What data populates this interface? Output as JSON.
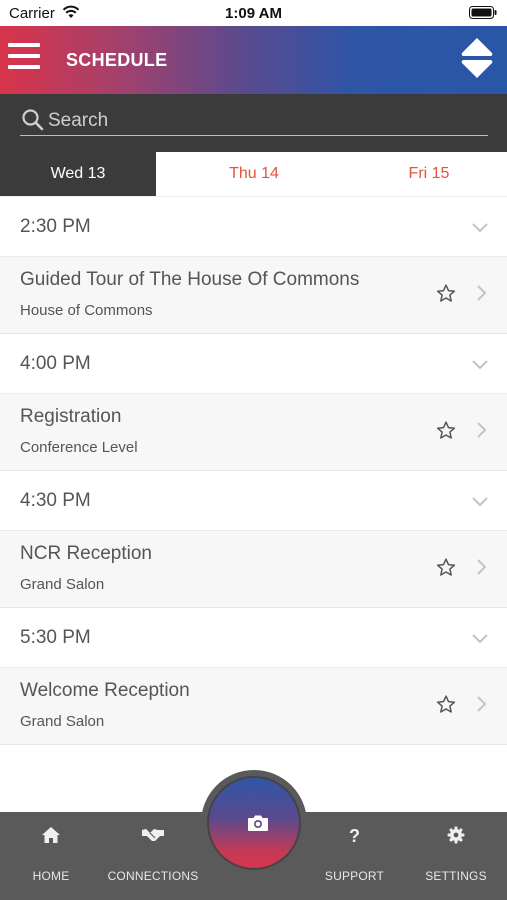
{
  "status_bar": {
    "carrier": "Carrier",
    "time": "1:09 AM"
  },
  "header": {
    "title": "SCHEDULE",
    "menu_icon": "hamburger-menu-icon",
    "sort_icon": "sort-up-down-icon"
  },
  "search": {
    "placeholder": "Search",
    "value": ""
  },
  "tabs": [
    {
      "label": "Wed 13",
      "active": true
    },
    {
      "label": "Thu 14",
      "active": false
    },
    {
      "label": "Fri 15",
      "active": false
    }
  ],
  "schedule": [
    {
      "time": "2:30 PM",
      "event": {
        "title": "Guided Tour of The House Of Commons",
        "location": "House of Commons"
      }
    },
    {
      "time": "4:00 PM",
      "event": {
        "title": "Registration",
        "location": "Conference Level"
      }
    },
    {
      "time": "4:30 PM",
      "event": {
        "title": "NCR Reception",
        "location": "Grand Salon"
      }
    },
    {
      "time": "5:30 PM",
      "event": {
        "title": "Welcome Reception",
        "location": "Grand Salon"
      }
    }
  ],
  "bottom_nav": [
    {
      "label": "HOME",
      "icon": "home-icon"
    },
    {
      "label": "CONNECTIONS",
      "icon": "handshake-icon"
    },
    {
      "label": "SUPPORT",
      "icon": "question-icon"
    },
    {
      "label": "SETTINGS",
      "icon": "gear-icon"
    }
  ],
  "fab": {
    "icon": "camera-icon"
  },
  "colors": {
    "accent_red": "#d8344a",
    "accent_blue": "#2a56a8",
    "tab_inactive": "#e2553a",
    "dark_bar": "#3b3b3b",
    "nav_bg": "#5a5a5a"
  }
}
